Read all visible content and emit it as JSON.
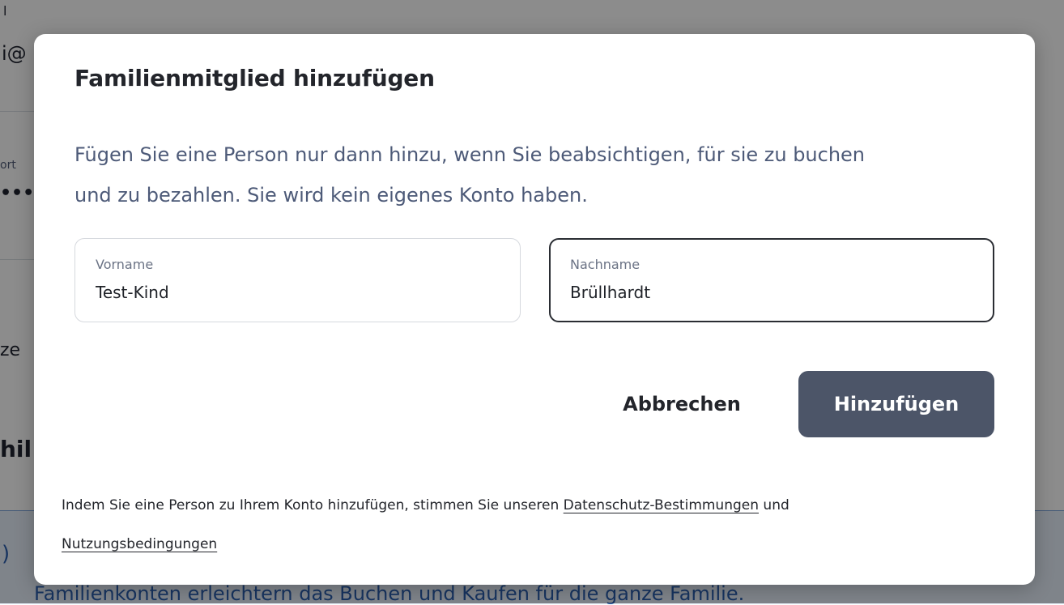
{
  "background": {
    "fragments": {
      "line1": "l",
      "email_fragment": "i@",
      "password_label_fragment": "ort",
      "password_dots": "•••",
      "fragment_ze": "ze",
      "heading_fragment": "hil",
      "banner_icon": ")",
      "banner_text": "Familienkonten erleichtern das Buchen und Kaufen für die ganze Familie."
    }
  },
  "modal": {
    "title": "Familienmitglied hinzufügen",
    "description": "Fügen Sie eine Person nur dann hinzu, wenn Sie beabsichtigen, für sie zu buchen und zu bezahlen. Sie wird kein eigenes Konto haben.",
    "fields": {
      "first_name": {
        "label": "Vorname",
        "value": "Test-Kind"
      },
      "last_name": {
        "label": "Nachname",
        "value": "Brüllhardt"
      }
    },
    "buttons": {
      "cancel": "Abbrechen",
      "add": "Hinzufügen"
    },
    "legal": {
      "prefix": "Indem Sie eine Person zu Ihrem Konto hinzufügen, stimmen Sie unseren ",
      "privacy_link": "Datenschutz-Bestimmungen",
      "connector": " und ",
      "terms_link": "Nutzungsbedingungen"
    }
  },
  "colors": {
    "primary_button": "#4c5568",
    "description_text": "#4d5a78",
    "focus_border": "#2a2d33",
    "spellcheck": "#e0262f"
  }
}
